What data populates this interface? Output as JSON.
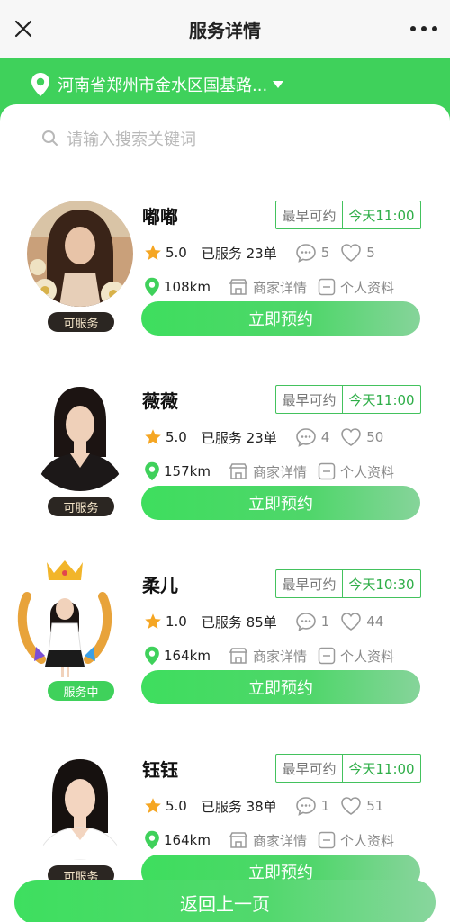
{
  "header": {
    "title": "服务详情"
  },
  "location": {
    "text": "河南省郑州市金水区国基路..."
  },
  "search": {
    "placeholder": "请输入搜索关键词"
  },
  "providers": [
    {
      "name": "嘟嘟",
      "booking_label": "最早可约",
      "booking_time": "今天11:00",
      "rating": "5.0",
      "served": "已服务 23单",
      "comments": "5",
      "likes": "5",
      "distance": "108km",
      "shop_link": "商家详情",
      "profile_link": "个人资料",
      "book_label": "立即预约",
      "status": "可服务"
    },
    {
      "name": "薇薇",
      "booking_label": "最早可约",
      "booking_time": "今天11:00",
      "rating": "5.0",
      "served": "已服务 23单",
      "comments": "4",
      "likes": "50",
      "distance": "157km",
      "shop_link": "商家详情",
      "profile_link": "个人资料",
      "book_label": "立即预约",
      "status": "可服务"
    },
    {
      "name": "柔儿",
      "booking_label": "最早可约",
      "booking_time": "今天10:30",
      "rating": "1.0",
      "served": "已服务 85单",
      "comments": "1",
      "likes": "44",
      "distance": "164km",
      "shop_link": "商家详情",
      "profile_link": "个人资料",
      "book_label": "立即预约",
      "status": "服务中"
    },
    {
      "name": "钰钰",
      "booking_label": "最早可约",
      "booking_time": "今天11:00",
      "rating": "5.0",
      "served": "已服务 38单",
      "comments": "1",
      "likes": "51",
      "distance": "164km",
      "shop_link": "商家详情",
      "profile_link": "个人资料",
      "book_label": "立即预约",
      "status": "可服务"
    }
  ],
  "footer": {
    "back_label": "返回上一页"
  },
  "colors": {
    "brand_green": "#3fd15b",
    "star": "#f5a623"
  },
  "icons": [
    "close-icon",
    "more-icon",
    "location-pin-icon",
    "caret-down-icon",
    "search-icon",
    "star-icon",
    "comment-icon",
    "heart-icon",
    "shop-icon",
    "profile-icon"
  ]
}
